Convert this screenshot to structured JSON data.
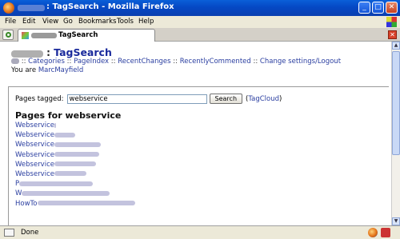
{
  "window": {
    "title": ": TagSearch - Mozilla Firefox"
  },
  "menu": [
    "File",
    "Edit",
    "View",
    "Go",
    "Bookmarks",
    "Tools",
    "Help"
  ],
  "tab": {
    "title": "TagSearch"
  },
  "page": {
    "title_sep": " : ",
    "title": "TagSearch",
    "nav_sep": ":: ",
    "nav": [
      "Categories",
      "PageIndex",
      "RecentChanges",
      "RecentlyCommented",
      "Change settings/Logout"
    ],
    "you_are": "You are",
    "user": "MarcMayfield"
  },
  "search": {
    "label": "Pages tagged:",
    "value": "webservice",
    "button": "Search",
    "tagcloud_open": "(",
    "tagcloud": "TagCloud",
    "tagcloud_close": ")"
  },
  "results": {
    "heading": "Pages for webservice",
    "items": [
      "Webservice",
      "Webservice",
      "Webservice",
      "Webservice",
      "Webservice",
      "Webservice",
      "P",
      "W",
      "HowTo"
    ]
  },
  "status": {
    "text": "Done"
  }
}
